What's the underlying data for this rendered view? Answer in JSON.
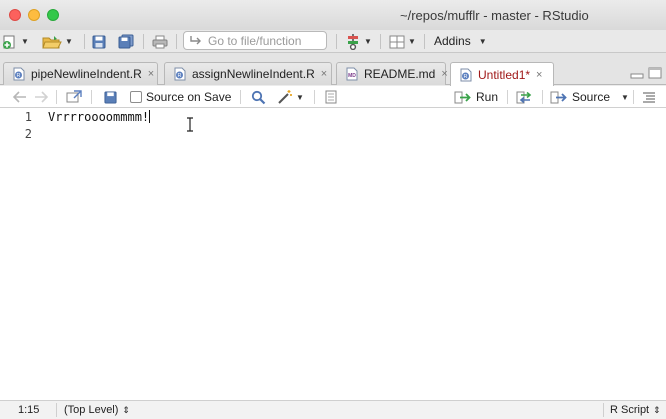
{
  "window": {
    "title": "~/repos/mufflr - master - RStudio"
  },
  "toolbar": {
    "goto_placeholder": "Go to file/function",
    "addins_label": "Addins"
  },
  "tabs": [
    {
      "label": "pipeNewlineIndent.R",
      "close": "×",
      "icon": "r-file-icon"
    },
    {
      "label": "assignNewlineIndent.R",
      "close": "×",
      "icon": "r-file-icon"
    },
    {
      "label": "README.md",
      "close": "×",
      "icon": "md-file-icon"
    },
    {
      "label": "Untitled1*",
      "close": "×",
      "icon": "r-file-icon",
      "active": true
    }
  ],
  "editor_toolbar": {
    "source_on_save_label": "Source on Save",
    "run_label": "Run",
    "source_label": "Source"
  },
  "editor": {
    "lines": [
      {
        "number": "1",
        "text": "Vrrrroooommmm!"
      },
      {
        "number": "2",
        "text": ""
      }
    ]
  },
  "status": {
    "position": "1:15",
    "scope": "(Top Level)",
    "file_type": "R Script"
  },
  "colors": {
    "active_tab_text": "#a01818",
    "close_button": "#fc615d",
    "minimize_button": "#fdbc40",
    "maximize_button": "#34c84a"
  }
}
